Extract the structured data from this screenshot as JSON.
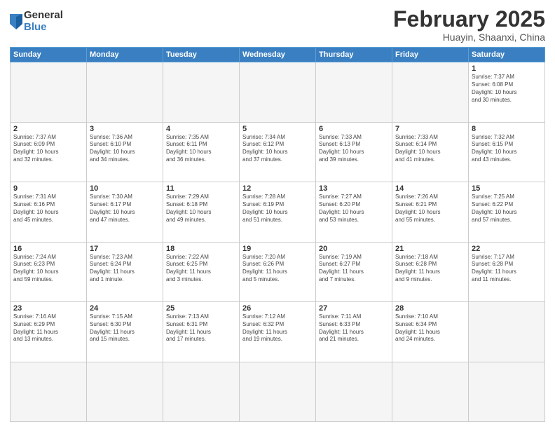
{
  "logo": {
    "general": "General",
    "blue": "Blue"
  },
  "title": "February 2025",
  "location": "Huayin, Shaanxi, China",
  "weekdays": [
    "Sunday",
    "Monday",
    "Tuesday",
    "Wednesday",
    "Thursday",
    "Friday",
    "Saturday"
  ],
  "days": [
    {
      "num": "",
      "info": ""
    },
    {
      "num": "",
      "info": ""
    },
    {
      "num": "",
      "info": ""
    },
    {
      "num": "",
      "info": ""
    },
    {
      "num": "",
      "info": ""
    },
    {
      "num": "",
      "info": ""
    },
    {
      "num": "1",
      "info": "Sunrise: 7:37 AM\nSunset: 6:08 PM\nDaylight: 10 hours\nand 30 minutes."
    },
    {
      "num": "2",
      "info": "Sunrise: 7:37 AM\nSunset: 6:09 PM\nDaylight: 10 hours\nand 32 minutes."
    },
    {
      "num": "3",
      "info": "Sunrise: 7:36 AM\nSunset: 6:10 PM\nDaylight: 10 hours\nand 34 minutes."
    },
    {
      "num": "4",
      "info": "Sunrise: 7:35 AM\nSunset: 6:11 PM\nDaylight: 10 hours\nand 36 minutes."
    },
    {
      "num": "5",
      "info": "Sunrise: 7:34 AM\nSunset: 6:12 PM\nDaylight: 10 hours\nand 37 minutes."
    },
    {
      "num": "6",
      "info": "Sunrise: 7:33 AM\nSunset: 6:13 PM\nDaylight: 10 hours\nand 39 minutes."
    },
    {
      "num": "7",
      "info": "Sunrise: 7:33 AM\nSunset: 6:14 PM\nDaylight: 10 hours\nand 41 minutes."
    },
    {
      "num": "8",
      "info": "Sunrise: 7:32 AM\nSunset: 6:15 PM\nDaylight: 10 hours\nand 43 minutes."
    },
    {
      "num": "9",
      "info": "Sunrise: 7:31 AM\nSunset: 6:16 PM\nDaylight: 10 hours\nand 45 minutes."
    },
    {
      "num": "10",
      "info": "Sunrise: 7:30 AM\nSunset: 6:17 PM\nDaylight: 10 hours\nand 47 minutes."
    },
    {
      "num": "11",
      "info": "Sunrise: 7:29 AM\nSunset: 6:18 PM\nDaylight: 10 hours\nand 49 minutes."
    },
    {
      "num": "12",
      "info": "Sunrise: 7:28 AM\nSunset: 6:19 PM\nDaylight: 10 hours\nand 51 minutes."
    },
    {
      "num": "13",
      "info": "Sunrise: 7:27 AM\nSunset: 6:20 PM\nDaylight: 10 hours\nand 53 minutes."
    },
    {
      "num": "14",
      "info": "Sunrise: 7:26 AM\nSunset: 6:21 PM\nDaylight: 10 hours\nand 55 minutes."
    },
    {
      "num": "15",
      "info": "Sunrise: 7:25 AM\nSunset: 6:22 PM\nDaylight: 10 hours\nand 57 minutes."
    },
    {
      "num": "16",
      "info": "Sunrise: 7:24 AM\nSunset: 6:23 PM\nDaylight: 10 hours\nand 59 minutes."
    },
    {
      "num": "17",
      "info": "Sunrise: 7:23 AM\nSunset: 6:24 PM\nDaylight: 11 hours\nand 1 minute."
    },
    {
      "num": "18",
      "info": "Sunrise: 7:22 AM\nSunset: 6:25 PM\nDaylight: 11 hours\nand 3 minutes."
    },
    {
      "num": "19",
      "info": "Sunrise: 7:20 AM\nSunset: 6:26 PM\nDaylight: 11 hours\nand 5 minutes."
    },
    {
      "num": "20",
      "info": "Sunrise: 7:19 AM\nSunset: 6:27 PM\nDaylight: 11 hours\nand 7 minutes."
    },
    {
      "num": "21",
      "info": "Sunrise: 7:18 AM\nSunset: 6:28 PM\nDaylight: 11 hours\nand 9 minutes."
    },
    {
      "num": "22",
      "info": "Sunrise: 7:17 AM\nSunset: 6:28 PM\nDaylight: 11 hours\nand 11 minutes."
    },
    {
      "num": "23",
      "info": "Sunrise: 7:16 AM\nSunset: 6:29 PM\nDaylight: 11 hours\nand 13 minutes."
    },
    {
      "num": "24",
      "info": "Sunrise: 7:15 AM\nSunset: 6:30 PM\nDaylight: 11 hours\nand 15 minutes."
    },
    {
      "num": "25",
      "info": "Sunrise: 7:13 AM\nSunset: 6:31 PM\nDaylight: 11 hours\nand 17 minutes."
    },
    {
      "num": "26",
      "info": "Sunrise: 7:12 AM\nSunset: 6:32 PM\nDaylight: 11 hours\nand 19 minutes."
    },
    {
      "num": "27",
      "info": "Sunrise: 7:11 AM\nSunset: 6:33 PM\nDaylight: 11 hours\nand 21 minutes."
    },
    {
      "num": "28",
      "info": "Sunrise: 7:10 AM\nSunset: 6:34 PM\nDaylight: 11 hours\nand 24 minutes."
    },
    {
      "num": "",
      "info": ""
    },
    {
      "num": "",
      "info": ""
    }
  ]
}
